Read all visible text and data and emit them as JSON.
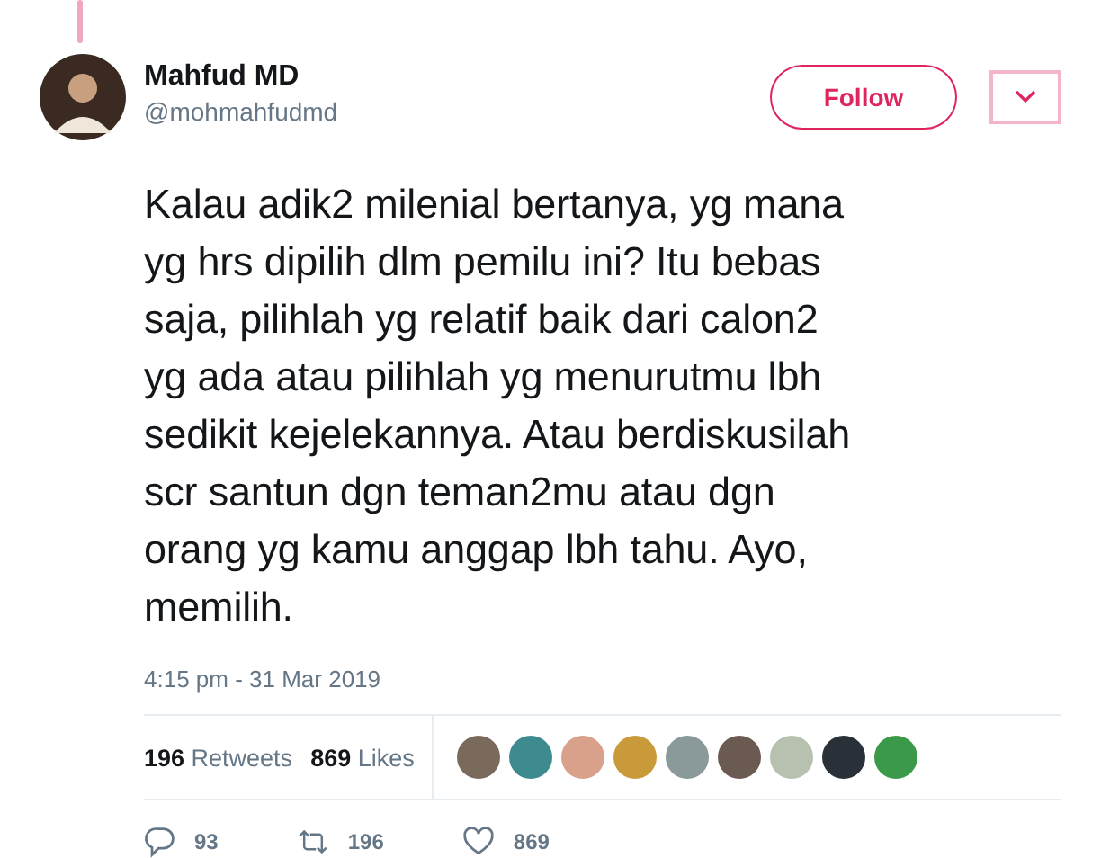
{
  "author": {
    "name": "Mahfud MD",
    "handle": "@mohmahfudmd"
  },
  "follow_button": {
    "label": "Follow"
  },
  "tweet": {
    "text": "Kalau adik2 milenial bertanya, yg mana\nyg hrs dipilih dlm pemilu ini? Itu bebas\nsaja, pilihlah yg relatif baik dari calon2\nyg ada atau pilihlah yg menurutmu lbh\nsedikit kejelekannya. Atau berdiskusilah\nscr santun dgn teman2mu atau dgn\norang yg kamu anggap lbh tahu. Ayo,\nmemilih.",
    "timestamp": "4:15 pm - 31 Mar 2019"
  },
  "stats": [
    {
      "count": "196",
      "label": "Retweets"
    },
    {
      "count": "869",
      "label": "Likes"
    }
  ],
  "likers": [
    {
      "color": "#7a6a5c"
    },
    {
      "color": "#3d8a8f"
    },
    {
      "color": "#d9a08a"
    },
    {
      "color": "#c99a3a"
    },
    {
      "color": "#8a9a9a"
    },
    {
      "color": "#6b5a52"
    },
    {
      "color": "#b8c0b0"
    },
    {
      "color": "#2a3038"
    },
    {
      "color": "#3a9a4a"
    }
  ],
  "actions": [
    {
      "kind": "reply",
      "count": "93"
    },
    {
      "kind": "retweet",
      "count": "196"
    },
    {
      "kind": "like",
      "count": "869"
    }
  ]
}
